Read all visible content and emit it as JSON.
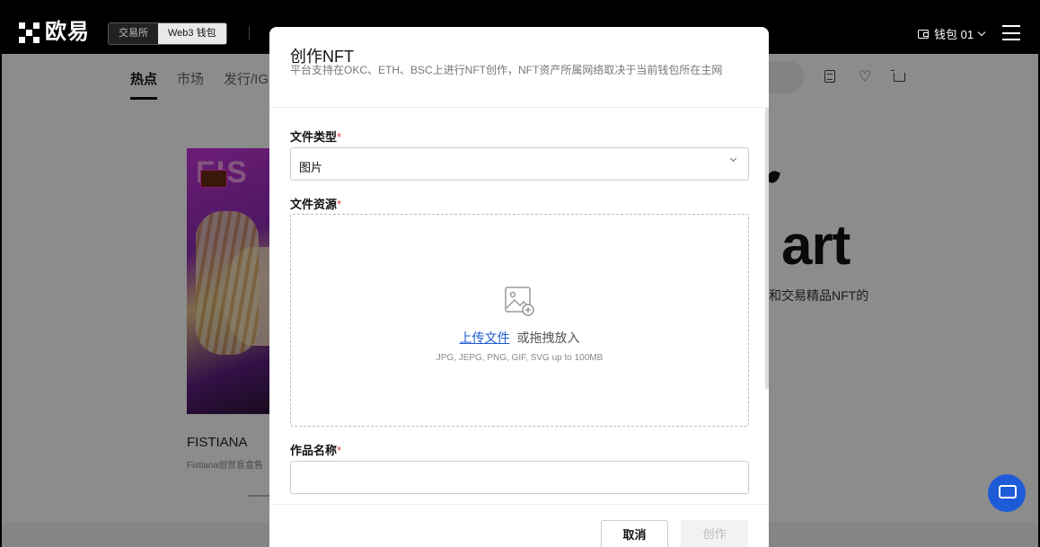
{
  "header": {
    "logo_text": "欧易",
    "mode_tabs": [
      {
        "label": "交易所",
        "active": false
      },
      {
        "label": "Web3 钱包",
        "active": true
      }
    ],
    "wallet_label": "钱包 01"
  },
  "page": {
    "nav_tabs": [
      {
        "label": "热点",
        "active": true
      },
      {
        "label": "市场",
        "active": false
      },
      {
        "label": "发行/IG",
        "active": false
      }
    ],
    "nft_card": {
      "art_text": "FIS",
      "name": "FISTIANA",
      "subtitle": "Fistiana创世盲盒售"
    },
    "hero": {
      "headline": "art",
      "description": "和交易精品NFT的"
    }
  },
  "modal": {
    "title": "创作NFT",
    "description": "平台支持在OKC、ETH、BSC上进行NFT创作，NFT资产所属网络取决于当前钱包所在主网",
    "file_type": {
      "label": "文件类型",
      "required_mark": "*",
      "value": "图片"
    },
    "file_source": {
      "label": "文件资源",
      "required_mark": "*",
      "upload_link": "上传文件",
      "upload_text": "或拖拽放入",
      "hint": "JPG, JEPG, PNG, GIF, SVG up to 100MB"
    },
    "work_name": {
      "label": "作品名称",
      "required_mark": "*",
      "value": ""
    },
    "buttons": {
      "cancel": "取消",
      "create": "创作"
    }
  },
  "colors": {
    "accent": "#1f5bd6",
    "required": "#e03a3a",
    "header_bg": "#000000"
  },
  "icons": [
    "okx-logo-icon",
    "wallet-icon",
    "chevron-down-icon",
    "menu-icon",
    "document-icon",
    "heart-icon",
    "cart-icon",
    "image-upload-icon",
    "chat-icon"
  ]
}
